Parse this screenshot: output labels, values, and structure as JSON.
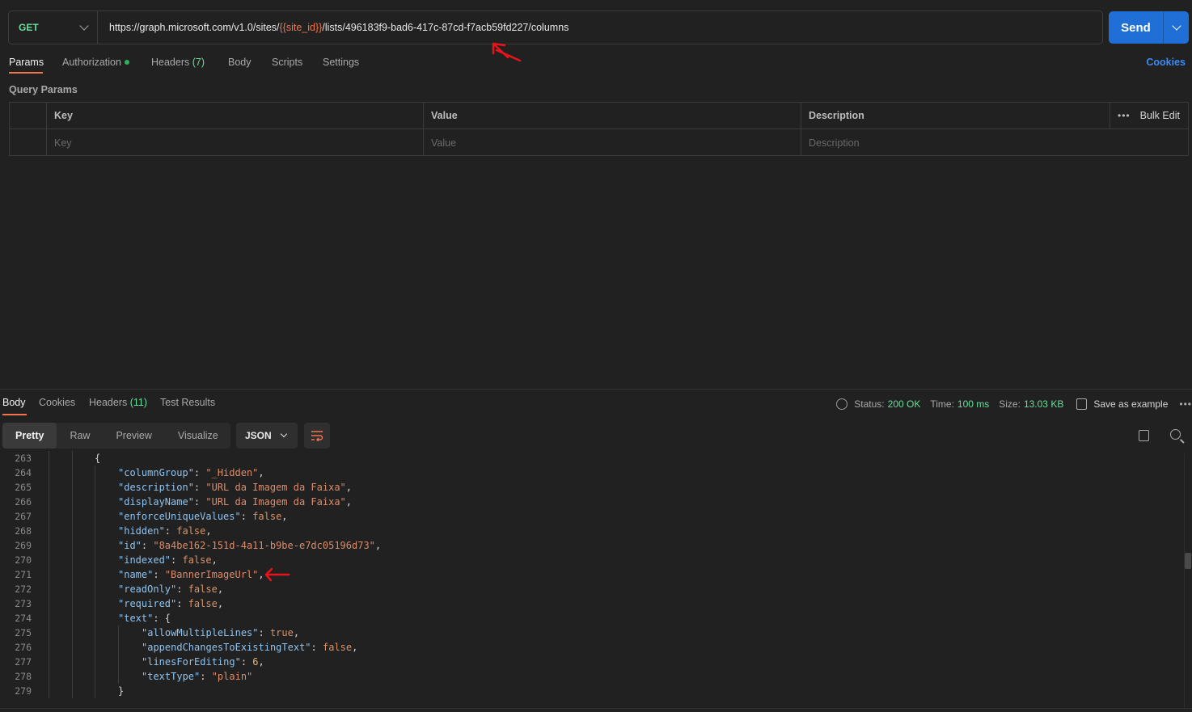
{
  "request": {
    "method": "GET",
    "url_prefix": "https://graph.microsoft.com/v1.0/sites/",
    "url_variable": "{{site_id}}",
    "url_suffix": "/lists/496183f9-bad6-417c-87cd-f7acb59fd227/columns",
    "send_label": "Send"
  },
  "request_tabs": {
    "params": "Params",
    "authorization": "Authorization",
    "headers": "Headers",
    "headers_count": "(7)",
    "body": "Body",
    "scripts": "Scripts",
    "settings": "Settings",
    "cookies": "Cookies"
  },
  "query_params": {
    "title": "Query Params",
    "headers": {
      "key": "Key",
      "value": "Value",
      "description": "Description",
      "bulk_edit": "Bulk Edit"
    },
    "placeholders": {
      "key": "Key",
      "value": "Value",
      "description": "Description"
    }
  },
  "response_tabs": {
    "body": "Body",
    "cookies": "Cookies",
    "headers": "Headers",
    "headers_count": "(11)",
    "test_results": "Test Results"
  },
  "response_status": {
    "status_label": "Status:",
    "status_value": "200 OK",
    "time_label": "Time:",
    "time_value": "100 ms",
    "size_label": "Size:",
    "size_value": "13.03 KB",
    "save_example": "Save as example"
  },
  "view_modes": [
    "Pretty",
    "Raw",
    "Preview",
    "Visualize"
  ],
  "format": "JSON",
  "code_lines": [
    {
      "n": "263",
      "indent": 2,
      "tokens": [
        [
          "p",
          "{"
        ]
      ]
    },
    {
      "n": "264",
      "indent": 3,
      "tokens": [
        [
          "k",
          "\"columnGroup\""
        ],
        [
          "p",
          ": "
        ],
        [
          "s",
          "\"_Hidden\""
        ],
        [
          "p",
          ","
        ]
      ]
    },
    {
      "n": "265",
      "indent": 3,
      "tokens": [
        [
          "k",
          "\"description\""
        ],
        [
          "p",
          ": "
        ],
        [
          "s",
          "\"URL da Imagem da Faixa\""
        ],
        [
          "p",
          ","
        ]
      ]
    },
    {
      "n": "266",
      "indent": 3,
      "tokens": [
        [
          "k",
          "\"displayName\""
        ],
        [
          "p",
          ": "
        ],
        [
          "s",
          "\"URL da Imagem da Faixa\""
        ],
        [
          "p",
          ","
        ]
      ]
    },
    {
      "n": "267",
      "indent": 3,
      "tokens": [
        [
          "k",
          "\"enforceUniqueValues\""
        ],
        [
          "p",
          ": "
        ],
        [
          "b",
          "false"
        ],
        [
          "p",
          ","
        ]
      ]
    },
    {
      "n": "268",
      "indent": 3,
      "tokens": [
        [
          "k",
          "\"hidden\""
        ],
        [
          "p",
          ": "
        ],
        [
          "b",
          "false"
        ],
        [
          "p",
          ","
        ]
      ]
    },
    {
      "n": "269",
      "indent": 3,
      "tokens": [
        [
          "k",
          "\"id\""
        ],
        [
          "p",
          ": "
        ],
        [
          "s",
          "\"8a4be162-151d-4a11-b9be-e7dc05196d73\""
        ],
        [
          "p",
          ","
        ]
      ]
    },
    {
      "n": "270",
      "indent": 3,
      "tokens": [
        [
          "k",
          "\"indexed\""
        ],
        [
          "p",
          ": "
        ],
        [
          "b",
          "false"
        ],
        [
          "p",
          ","
        ]
      ]
    },
    {
      "n": "271",
      "indent": 3,
      "tokens": [
        [
          "k",
          "\"name\""
        ],
        [
          "p",
          ": "
        ],
        [
          "s",
          "\"BannerImageUrl\""
        ],
        [
          "p",
          ","
        ]
      ]
    },
    {
      "n": "272",
      "indent": 3,
      "tokens": [
        [
          "k",
          "\"readOnly\""
        ],
        [
          "p",
          ": "
        ],
        [
          "b",
          "false"
        ],
        [
          "p",
          ","
        ]
      ]
    },
    {
      "n": "273",
      "indent": 3,
      "tokens": [
        [
          "k",
          "\"required\""
        ],
        [
          "p",
          ": "
        ],
        [
          "b",
          "false"
        ],
        [
          "p",
          ","
        ]
      ]
    },
    {
      "n": "274",
      "indent": 3,
      "tokens": [
        [
          "k",
          "\"text\""
        ],
        [
          "p",
          ": {"
        ]
      ]
    },
    {
      "n": "275",
      "indent": 4,
      "tokens": [
        [
          "k",
          "\"allowMultipleLines\""
        ],
        [
          "p",
          ": "
        ],
        [
          "b",
          "true"
        ],
        [
          "p",
          ","
        ]
      ]
    },
    {
      "n": "276",
      "indent": 4,
      "tokens": [
        [
          "k",
          "\"appendChangesToExistingText\""
        ],
        [
          "p",
          ": "
        ],
        [
          "b",
          "false"
        ],
        [
          "p",
          ","
        ]
      ]
    },
    {
      "n": "277",
      "indent": 4,
      "tokens": [
        [
          "k",
          "\"linesForEditing\""
        ],
        [
          "p",
          ": "
        ],
        [
          "n",
          "6"
        ],
        [
          "p",
          ","
        ]
      ]
    },
    {
      "n": "278",
      "indent": 4,
      "tokens": [
        [
          "k",
          "\"textType\""
        ],
        [
          "p",
          ": "
        ],
        [
          "s",
          "\"plain\""
        ]
      ]
    },
    {
      "n": "279",
      "indent": 3,
      "tokens": [
        [
          "p",
          "}"
        ]
      ]
    }
  ],
  "colors": {
    "accent_orange": "#f0744c",
    "method_green": "#6bdd9a",
    "send_blue": "#1f6fd6",
    "annotation_red": "#e8141a"
  },
  "icons": [
    "chevron-down-icon",
    "globe-icon",
    "save-icon",
    "more-icon",
    "wrap-lines-icon",
    "copy-icon",
    "search-icon"
  ]
}
